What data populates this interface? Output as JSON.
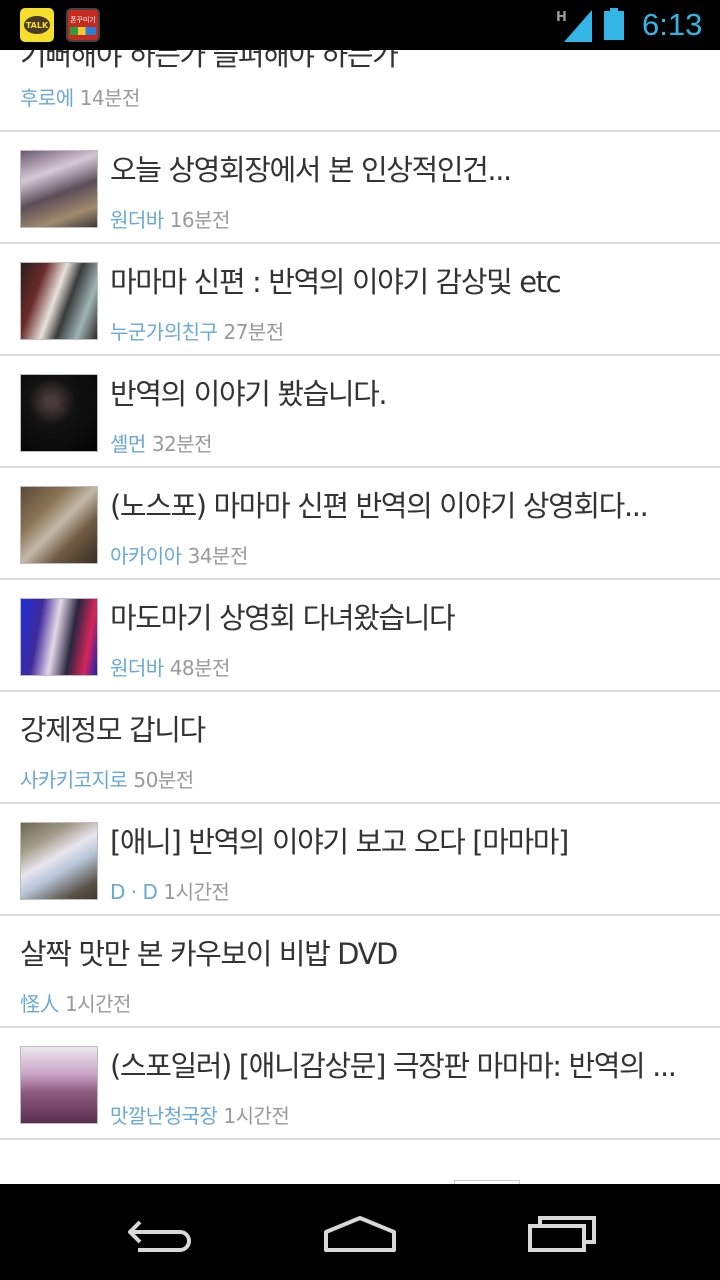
{
  "status_bar": {
    "time": "6:13",
    "network_type": "H",
    "notifications": [
      {
        "icon": "kakaotalk-icon",
        "label": "TALK"
      },
      {
        "icon": "app-notification-icon",
        "label": "폰꾸미기"
      }
    ],
    "colors": {
      "accent": "#33b5e5"
    }
  },
  "feed": {
    "partial_item": {
      "title": "기뻐해야 하는가 슬퍼해야 하는가",
      "author": "후로에",
      "time": "14분전"
    },
    "items": [
      {
        "title": "오늘 상영회장에서 본 인상적인건...",
        "author": "원더바",
        "time": "16분전",
        "has_thumb": true
      },
      {
        "title": "마마마 신편 : 반역의 이야기 감상및 etc",
        "author": "누군가의친구",
        "time": "27분전",
        "has_thumb": true
      },
      {
        "title": "반역의 이야기 봤습니다.",
        "author": "셸먼",
        "time": "32분전",
        "has_thumb": true
      },
      {
        "title": "(노스포) 마마마 신편 반역의 이야기 상영회다...",
        "author": "아카이아",
        "time": "34분전",
        "has_thumb": true
      },
      {
        "title": "마도마기 상영회 다녀왔습니다",
        "author": "원더바",
        "time": "48분전",
        "has_thumb": true
      },
      {
        "title": "강제정모 갑니다",
        "author": "사카키코지로",
        "time": "50분전",
        "has_thumb": false
      },
      {
        "title": "[애니] 반역의 이야기 보고 오다 [마마마]",
        "author": "D · D",
        "time": "1시간전",
        "has_thumb": true
      },
      {
        "title": "살짝 맛만 본 카우보이 비밥 DVD",
        "author": "怪人",
        "time": "1시간전",
        "has_thumb": false
      },
      {
        "title": "(스포일러) [애니감상문] 극장판 마마마: 반역의 ...",
        "author": "맛깔난청국장",
        "time": "1시간전",
        "has_thumb": true
      }
    ],
    "colors": {
      "author": "#6aa8d6",
      "time": "#9a9a9a",
      "title": "#333333",
      "divider": "#dcdcdc"
    }
  },
  "nav_bar": {
    "buttons": [
      {
        "icon": "back-icon"
      },
      {
        "icon": "home-icon"
      },
      {
        "icon": "recent-apps-icon"
      }
    ]
  }
}
